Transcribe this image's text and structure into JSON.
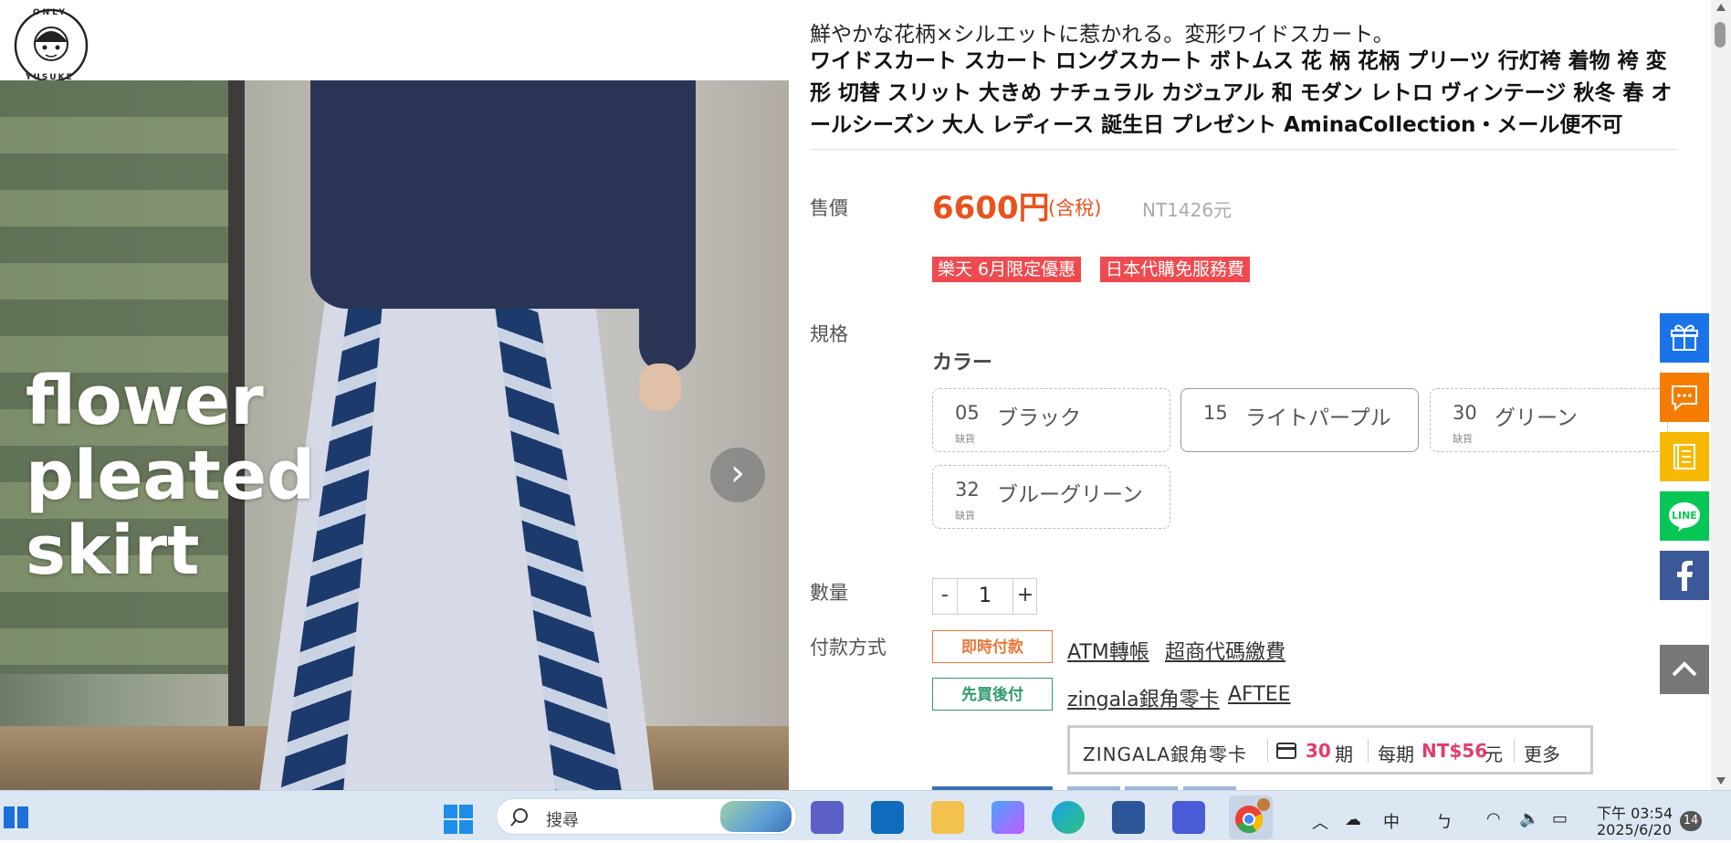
{
  "logo": {
    "top_text": "ONLY",
    "bottom_text": "YUSUKE"
  },
  "photo": {
    "overlay_text": "flower\npleated\nskirt"
  },
  "product": {
    "subtitle": "鮮やかな花柄×シルエットに惹かれる。変形ワイドスカート。",
    "title": "ワイドスカート スカート ロングスカート ボトムス 花 柄 花柄 プリーツ 行灯袴 着物 袴 変形 切替 スリット 大きめ ナチュラル カジュアル 和 モダン レトロ ヴィンテージ 秋冬 春 オールシーズン 大人 レディース 誕生日 プレゼント AminaCollection・メール便不可"
  },
  "price": {
    "label": "售價",
    "value": "6600円",
    "tax": "(含稅)",
    "nt": "NT1426元"
  },
  "promos": [
    "樂天 6月限定優惠",
    "日本代購免服務費"
  ],
  "spec": {
    "label": "規格",
    "group": "カラー",
    "options": [
      {
        "code": "05",
        "name": "ブラック",
        "status": "缺貨",
        "available": false
      },
      {
        "code": "15",
        "name": "ライトパープル",
        "status": "",
        "available": true
      },
      {
        "code": "30",
        "name": "グリーン",
        "status": "缺貨",
        "available": false
      },
      {
        "code": "32",
        "name": "ブルーグリーン",
        "status": "缺貨",
        "available": false
      }
    ]
  },
  "quantity": {
    "label": "數量",
    "minus": "-",
    "value": "1",
    "plus": "+"
  },
  "payment": {
    "label": "付款方式",
    "instant_tag": "即時付款",
    "instant_methods": [
      "ATM轉帳",
      "超商代碼繳費"
    ],
    "bnpl_tag": "先買後付",
    "bnpl_methods": [
      "zingala銀角零卡",
      "AFTEE"
    ],
    "zingala": {
      "brand": "ZINGALA銀角零卡",
      "periods": "30",
      "period_unit": "期",
      "per_label": "每期",
      "per_amount": "NT$56",
      "per_unit": "元",
      "more": "更多"
    }
  },
  "floating": [
    "gift-icon",
    "chat-icon",
    "book-icon",
    "line-icon",
    "facebook-icon"
  ],
  "floating_colors": {
    "gift": "#1a73e8",
    "chat": "#f57c00",
    "book": "#f7b900",
    "line": "#06c755",
    "facebook": "#3b5998"
  },
  "line_label": "LINE",
  "taskbar": {
    "search_placeholder": "搜尋",
    "ime_lang": "中",
    "ime_mode": "ㄅ",
    "time": "下午 03:54",
    "date": "2025/6/20",
    "notifications": "14"
  },
  "accent": "#e8531d"
}
